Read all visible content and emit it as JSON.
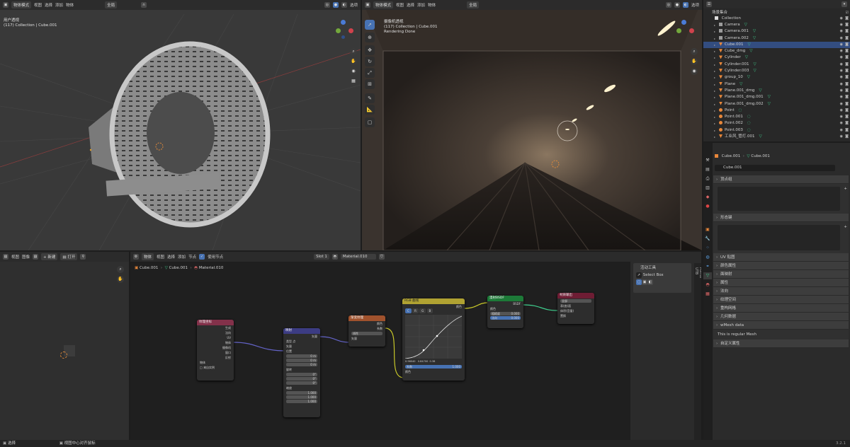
{
  "viewport_left": {
    "header": {
      "mode": "物体模式",
      "menus": [
        "视图",
        "选择",
        "添加",
        "物体"
      ],
      "orientation": "全局",
      "right_label": "选项"
    },
    "overlay": {
      "line1": "用户透视",
      "line2": "(117) Collection | Cube.001"
    }
  },
  "viewport_right": {
    "header": {
      "mode": "物体模式",
      "menus": [
        "视图",
        "选择",
        "添加",
        "物体"
      ],
      "orientation": "全局",
      "right_label": "选项"
    },
    "overlay": {
      "line1": "摄像机透视",
      "line2": "(117) Collection | Cube.001",
      "line3": "Rendering Done"
    }
  },
  "outliner": {
    "title": "场景集合",
    "collection": "Collection",
    "items": [
      {
        "name": "Camera",
        "type": "camera"
      },
      {
        "name": "Camera.001",
        "type": "camera"
      },
      {
        "name": "Camera.002",
        "type": "camera"
      },
      {
        "name": "Cube.001",
        "type": "mesh",
        "selected": true
      },
      {
        "name": "Cube_dmg",
        "type": "mesh"
      },
      {
        "name": "Cylinder",
        "type": "mesh"
      },
      {
        "name": "Cylinder.001",
        "type": "mesh"
      },
      {
        "name": "Cylinder.003",
        "type": "mesh"
      },
      {
        "name": "group_10",
        "type": "mesh"
      },
      {
        "name": "Plane",
        "type": "mesh"
      },
      {
        "name": "Plane.001_dmg",
        "type": "mesh"
      },
      {
        "name": "Plane.001_dmg.001",
        "type": "mesh"
      },
      {
        "name": "Plane.001_dmg.002",
        "type": "mesh"
      },
      {
        "name": "Point",
        "type": "light"
      },
      {
        "name": "Point.001",
        "type": "light"
      },
      {
        "name": "Point.002",
        "type": "light"
      },
      {
        "name": "Point.003",
        "type": "light"
      },
      {
        "name": "工业风_管灯.001",
        "type": "mesh"
      }
    ]
  },
  "properties": {
    "breadcrumb_object": "Cube.001",
    "breadcrumb_data": "Cube.001",
    "data_name": "Cube.001",
    "panels": {
      "vertex_groups": "顶点组",
      "shape_keys": "形态键",
      "uv_maps": "UV 贴图",
      "color_attributes": "颜色属性",
      "face_maps": "面映射",
      "attributes": "属性",
      "normals": "法向",
      "texture_space": "纹理空间",
      "remesh": "重构网格",
      "geometry_data": "几何数据",
      "wmesh": "wMesh data",
      "wmesh_text": "This is regular Mesh",
      "custom_props": "自定义属性"
    }
  },
  "image_editor": {
    "header": {
      "menus": [
        "视图",
        "图像"
      ],
      "new_label": "新建",
      "open_label": "打开"
    }
  },
  "node_editor": {
    "header": {
      "object_label": "物体",
      "menus": [
        "视图",
        "选择",
        "添加",
        "节点"
      ],
      "use_nodes": "使用节点",
      "slot": "Slot 1",
      "material": "Material.010"
    },
    "breadcrumb": [
      "Cube.001",
      "Cube.001",
      "Material.010"
    ],
    "sidebar": {
      "title": "活动工具",
      "tool": "Select Box",
      "tabs": [
        "节点",
        "工具",
        "视图",
        "Node Wrangler",
        "Points",
        "UTB"
      ]
    },
    "nodes": {
      "texcoord": {
        "title": "纹理坐标",
        "outputs": [
          "生成",
          "法向",
          "UV",
          "物体",
          "摄像机",
          "窗口",
          "反射"
        ],
        "field_label": "物体",
        "checkbox": "来自实例"
      },
      "mapping": {
        "title": "映射",
        "output": "矢量",
        "type_label": "类型",
        "type_value": "点",
        "inputs": [
          "矢量",
          "位置"
        ],
        "loc": [
          "0 m",
          "0 m",
          "0 m"
        ],
        "rot_label": "旋转",
        "rot": [
          "0°",
          "0°",
          "0°"
        ],
        "scale_label": "缩放",
        "scale": [
          "1.000",
          "1.000",
          "1.000"
        ],
        "xyz": [
          "X",
          "Y",
          "Z"
        ]
      },
      "gradient": {
        "title": "渐变纹理",
        "outputs": [
          "颜色",
          "系数"
        ],
        "type": "线性",
        "input": "矢量"
      },
      "curves": {
        "title": "RGB 曲线",
        "output": "颜色",
        "tabs": [
          "C",
          "R",
          "G",
          "B"
        ],
        "stats": [
          "0.96040",
          "0.84700",
          "0.38"
        ],
        "factor_label": "系数",
        "factor": "1.000",
        "input": "颜色"
      },
      "bsdf": {
        "title": "漫射BSDF",
        "output": "BSDF",
        "color_label": "颜色",
        "rough_label": "粗糙度",
        "rough": "0.000",
        "normal_label": "法向",
        "normal": "0.000"
      },
      "output": {
        "title": "材质输出",
        "target": "全部",
        "inputs": [
          "表(曲)面",
          "体积(音量)",
          "置换"
        ]
      }
    }
  },
  "status_bar": {
    "left": "选择",
    "middle": "视图中心对齐鼠标",
    "version": "3.2.1"
  },
  "colors": {
    "accent": "#4772b3",
    "texcoord_header": "#83314a",
    "mapping_header": "#3c3c83",
    "gradient_header": "#a0522d",
    "curves_header": "#b0a232",
    "bsdf_header": "#1d7a38",
    "output_header": "#6e1d34"
  }
}
